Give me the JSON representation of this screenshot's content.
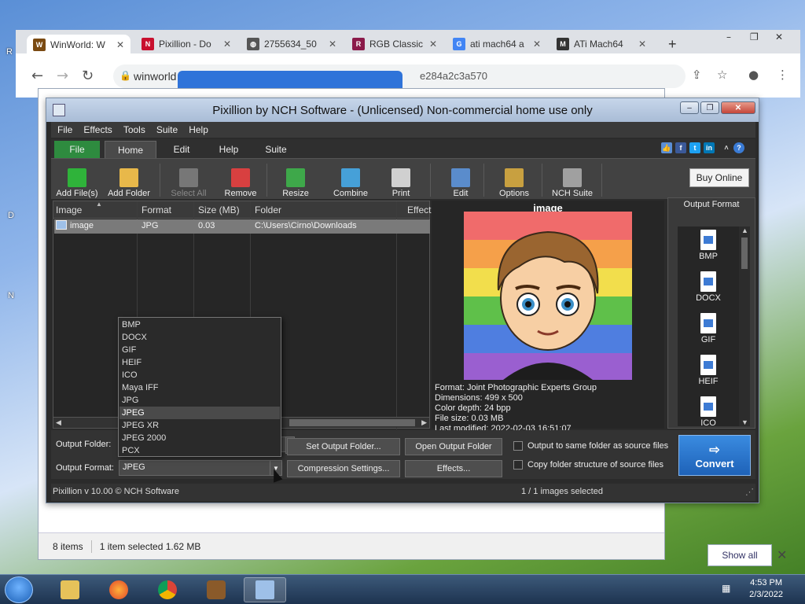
{
  "browser": {
    "tabs": [
      {
        "label": "WinWorld: W",
        "favicon": "W",
        "color": "#7a4a12"
      },
      {
        "label": "Pixillion - Do",
        "favicon": "N",
        "color": "#c8102e"
      },
      {
        "label": "2755634_50",
        "favicon": "◍",
        "color": "#555555"
      },
      {
        "label": "RGB Classic",
        "favicon": "R",
        "color": "#8b1a4a"
      },
      {
        "label": "ati mach64 a",
        "favicon": "G",
        "color": "#4285f4"
      },
      {
        "label": "ATi Mach64",
        "favicon": "M",
        "color": "#333333"
      }
    ],
    "url_start": "winworld",
    "url_end": "e284a2c3a570"
  },
  "explorer": {
    "item_count": "8 items",
    "selection": "1 item selected  1.62 MB",
    "show_all": "Show all"
  },
  "pixillion": {
    "title": "Pixillion by NCH Software - (Unlicensed) Non-commercial home use only",
    "menu": [
      "File",
      "Effects",
      "Tools",
      "Suite",
      "Help"
    ],
    "ribbon_tabs": [
      "File",
      "Home",
      "Edit",
      "Help",
      "Suite"
    ],
    "toolbar": [
      {
        "label": "Add File(s)",
        "icon": "plus-icon",
        "color": "#2fb33a",
        "enabled": true
      },
      {
        "label": "Add Folder",
        "icon": "folder-icon",
        "color": "#e8b84a",
        "enabled": true
      },
      {
        "label": "Select All",
        "icon": "select-all-icon",
        "color": "#777777",
        "enabled": false
      },
      {
        "label": "Remove",
        "icon": "remove-icon",
        "color": "#d84040",
        "enabled": true
      },
      {
        "label": "Resize",
        "icon": "resize-icon",
        "color": "#3ea84a",
        "enabled": true
      },
      {
        "label": "Combine",
        "icon": "combine-icon",
        "color": "#46a0d8",
        "enabled": true
      },
      {
        "label": "Print",
        "icon": "printer-icon",
        "color": "#d0d0d0",
        "enabled": true
      },
      {
        "label": "Edit",
        "icon": "edit-image-icon",
        "color": "#5a8ccc",
        "enabled": true
      },
      {
        "label": "Options",
        "icon": "options-icon",
        "color": "#c8a040",
        "enabled": true
      },
      {
        "label": "NCH Suite",
        "icon": "nch-suite-icon",
        "color": "#a0a0a0",
        "enabled": true
      }
    ],
    "buy_online": "Buy Online",
    "filelist": {
      "columns": [
        "Image",
        "Format",
        "Size (MB)",
        "Folder",
        "Effect"
      ],
      "rows": [
        {
          "image": "image",
          "format": "JPG",
          "size": "0.03",
          "folder": "C:\\Users\\Cirno\\Downloads"
        }
      ]
    },
    "preview": {
      "title": "image",
      "format": "Format: Joint Photographic Experts Group",
      "dimensions": "Dimensions: 499 x 500",
      "color_depth": "Color depth: 24 bpp",
      "file_size": "File size: 0.03 MB",
      "last_modified": "Last modified: 2022-02-03 16:51:07"
    },
    "output_format_panel": {
      "title": "Output Format",
      "items": [
        "BMP",
        "DOCX",
        "GIF",
        "HEIF",
        "ICO"
      ]
    },
    "bottom": {
      "output_folder_label": "Output Folder:",
      "output_format_label": "Output Format:",
      "output_format_value": "JPEG",
      "set_output_folder": "Set Output Folder...",
      "open_output_folder": "Open Output Folder",
      "compression_settings": "Compression Settings...",
      "effects": "Effects...",
      "same_folder": "Output to same folder as source files",
      "copy_structure": "Copy folder structure of source files",
      "convert": "Convert"
    },
    "status": {
      "version": "Pixillion v 10.00 © NCH Software",
      "selection": "1 / 1 images selected"
    },
    "dropdown": {
      "options": [
        "BMP",
        "DOCX",
        "GIF",
        "HEIF",
        "ICO",
        "Maya IFF",
        "JPG",
        "JPEG",
        "JPEG XR",
        "JPEG 2000",
        "PCX"
      ],
      "selected": "JPEG"
    }
  },
  "taskbar": {
    "time": "4:53 PM",
    "date": "2/3/2022"
  }
}
